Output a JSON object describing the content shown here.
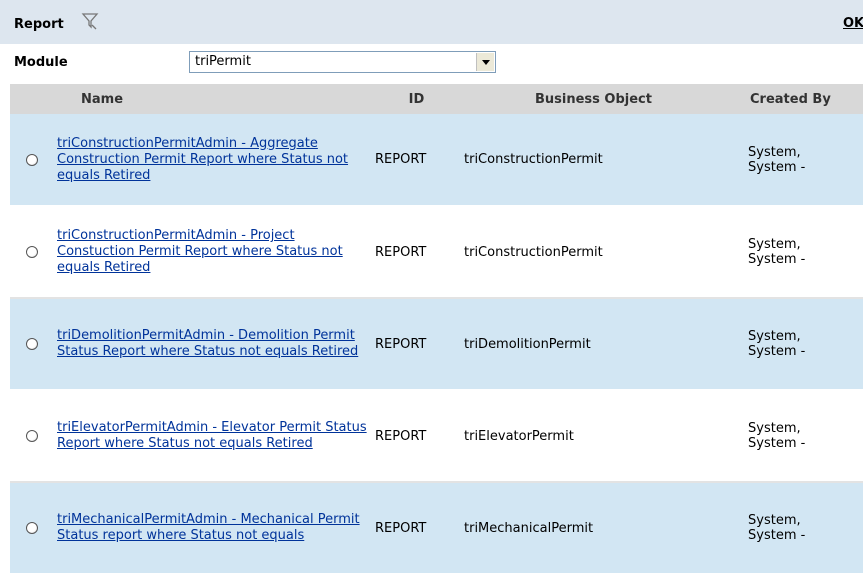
{
  "header": {
    "title": "Report",
    "ok_label": "OK"
  },
  "module": {
    "label": "Module",
    "selected": "triPermit"
  },
  "table": {
    "columns": [
      "Name",
      "ID",
      "Business Object",
      "Created By"
    ],
    "rows": [
      {
        "name": "triConstructionPermitAdmin - Aggregate Construction Permit Report where Status not equals Retired",
        "id": "REPORT",
        "business_object": "triConstructionPermit",
        "created_by": "System, System -"
      },
      {
        "name": "triConstructionPermitAdmin - Project Constuction Permit Report where Status not equals Retired",
        "id": "REPORT",
        "business_object": "triConstructionPermit",
        "created_by": "System, System -"
      },
      {
        "name": "triDemolitionPermitAdmin - Demolition Permit Status Report where Status not equals Retired",
        "id": "REPORT",
        "business_object": "triDemolitionPermit",
        "created_by": "System, System -"
      },
      {
        "name": "triElevatorPermitAdmin - Elevator Permit Status Report where Status not equals Retired",
        "id": "REPORT",
        "business_object": "triElevatorPermit",
        "created_by": "System, System -"
      },
      {
        "name": "triMechanicalPermitAdmin - Mechanical Permit Status report where Status not equals",
        "id": "REPORT",
        "business_object": "triMechanicalPermit",
        "created_by": "System, System -"
      }
    ]
  }
}
